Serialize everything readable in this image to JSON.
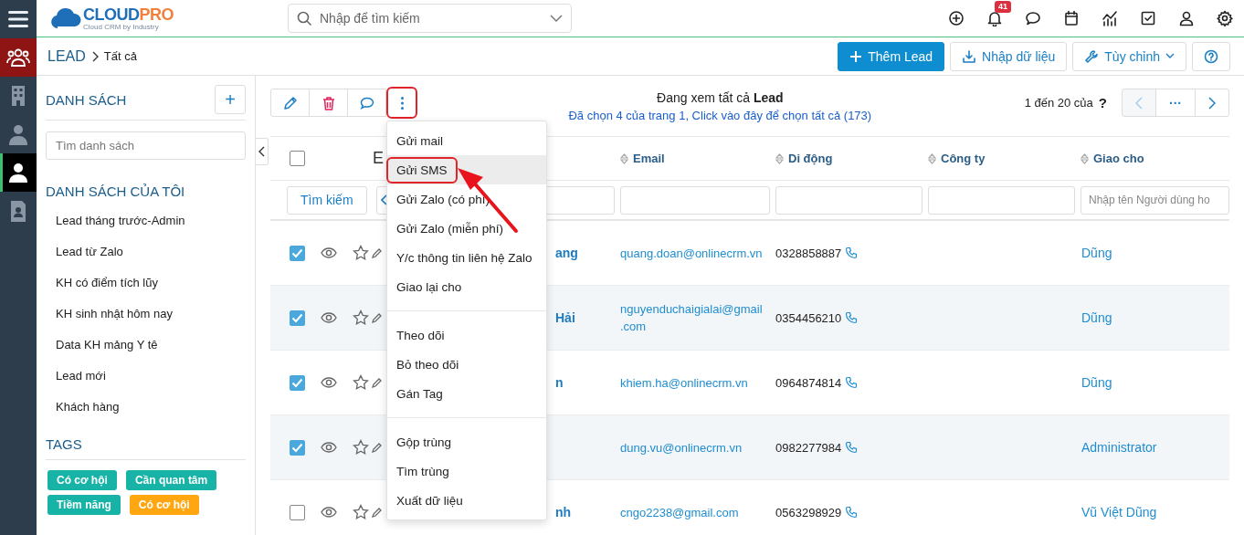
{
  "rail": [
    {
      "kind": "menu",
      "module": false,
      "selected": false
    },
    {
      "kind": "people",
      "module": true,
      "selected": false
    },
    {
      "kind": "building",
      "module": false,
      "selected": false
    },
    {
      "kind": "manager",
      "module": false,
      "selected": false
    },
    {
      "kind": "person",
      "module": false,
      "selected": true
    },
    {
      "kind": "contact",
      "module": false,
      "selected": false
    }
  ],
  "logo": {
    "parts": [
      {
        "text": "CLOUD",
        "color": "#1f6fb8"
      },
      {
        "text": "PRO",
        "color": "#f0803c"
      }
    ],
    "tagline": "Cloud CRM by Industry"
  },
  "search": {
    "placeholder": "Nhập để tìm kiếm"
  },
  "top_icons": [
    {
      "kind": "add"
    },
    {
      "kind": "bell",
      "badge": "41"
    },
    {
      "kind": "chat"
    },
    {
      "kind": "calendar"
    },
    {
      "kind": "chart"
    },
    {
      "kind": "task"
    },
    {
      "kind": "user"
    },
    {
      "kind": "settings"
    }
  ],
  "breadcrumb": {
    "module": "LEAD",
    "page": "Tất cả"
  },
  "actions": [
    {
      "kind": "primary",
      "label": "Thêm Lead"
    },
    {
      "kind": "import",
      "label": "Nhập dữ liệu"
    },
    {
      "kind": "customize",
      "label": "Tùy chỉnh"
    },
    {
      "kind": "help"
    }
  ],
  "sidebar": {
    "title": "DANH SÁCH",
    "add": "+",
    "search_placeholder": "Tìm danh sách",
    "my_lists_title": "DANH SÁCH CỦA TÔI",
    "items": [
      "Lead tháng trước-Admin",
      "Lead từ Zalo",
      "KH có điểm tích lũy",
      "KH sinh nhật hôm nay",
      "Data KH mảng Y tê",
      "Lead mới",
      "Khách hàng"
    ],
    "tags_title": "TAGS",
    "tags": [
      {
        "label": "Có cơ hội",
        "color": "#16b3a6"
      },
      {
        "label": "Cần quan tâm",
        "color": "#16b3a6"
      },
      {
        "label": "Tiềm năng",
        "color": "#16b3a6"
      },
      {
        "label": "Có cơ hội",
        "color": "#ffa611"
      }
    ]
  },
  "toolbar": {
    "buttons": [
      {
        "kind": "edit",
        "highlighted": false
      },
      {
        "kind": "delete",
        "highlighted": false
      },
      {
        "kind": "comment",
        "highlighted": false
      },
      {
        "kind": "more",
        "highlighted": true
      }
    ],
    "view_title": "Đang xem tất cả **Lead**",
    "selection_note": "Đã chọn 4 của trang 1, Click vào đây để chọn tất cả (173)",
    "pager_text": "1 đến 20 của",
    "pager_help": "?",
    "pager_more": "···",
    "prev_disabled": true
  },
  "table": {
    "header_checked": false,
    "columns": [
      {
        "label": "E",
        "sortable": false
      },
      {
        "label": "Email",
        "sortable": true
      },
      {
        "label": "Di động",
        "sortable": true
      },
      {
        "label": "Công ty",
        "sortable": true
      },
      {
        "label": "Giao cho",
        "sortable": true
      }
    ],
    "search_button": "Tìm kiếm",
    "filters": [
      {
        "kind": "range"
      },
      {
        "kind": "text"
      },
      {
        "kind": "text"
      },
      {
        "kind": "text"
      },
      {
        "kind": "text",
        "placeholder": "Nhập tên Người dùng ho"
      }
    ],
    "rows": [
      {
        "checked": true,
        "name": "ang",
        "email": "quang.doan@onlinecrm.vn",
        "mobile": "0328858887",
        "assigned": "Dũng"
      },
      {
        "checked": true,
        "name": "Hải",
        "email": "nguyenduchaigialai@gmail.com",
        "mobile": "0354456210",
        "assigned": "Dũng"
      },
      {
        "checked": true,
        "name": "n",
        "email": "khiem.ha@onlinecrm.vn",
        "mobile": "0964874814",
        "assigned": "Dũng"
      },
      {
        "checked": true,
        "name": "",
        "email": "dung.vu@onlinecrm.vn",
        "mobile": "0982277984",
        "assigned": "Administrator"
      },
      {
        "checked": false,
        "name": "nh",
        "email": "cngo2238@gmail.com",
        "mobile": "0563298929",
        "assigned": "Vũ Việt Dũng"
      }
    ]
  },
  "menu": {
    "open": true,
    "groups": [
      [
        {
          "label": "Gửi mail",
          "selected": false,
          "highlighted": false
        },
        {
          "label": "Gửi SMS",
          "selected": true,
          "highlighted": true
        },
        {
          "label": "Gửi Zalo (có phí)",
          "selected": false,
          "highlighted": false
        },
        {
          "label": "Gửi Zalo (miễn phí)",
          "selected": false,
          "highlighted": false
        },
        {
          "label": "Y/c thông tin liên hệ Zalo",
          "selected": false,
          "highlighted": false
        },
        {
          "label": "Giao lại cho",
          "selected": false,
          "highlighted": false
        }
      ],
      [
        {
          "label": "Theo dõi",
          "selected": false,
          "highlighted": false
        },
        {
          "label": "Bỏ theo dõi",
          "selected": false,
          "highlighted": false
        },
        {
          "label": "Gán Tag",
          "selected": false,
          "highlighted": false
        }
      ],
      [
        {
          "label": "Gộp trùng",
          "selected": false,
          "highlighted": false
        },
        {
          "label": "Tìm trùng",
          "selected": false,
          "highlighted": false
        },
        {
          "label": "Xuất dữ liệu",
          "selected": false,
          "highlighted": false
        }
      ]
    ]
  },
  "annotation_arrow": true
}
